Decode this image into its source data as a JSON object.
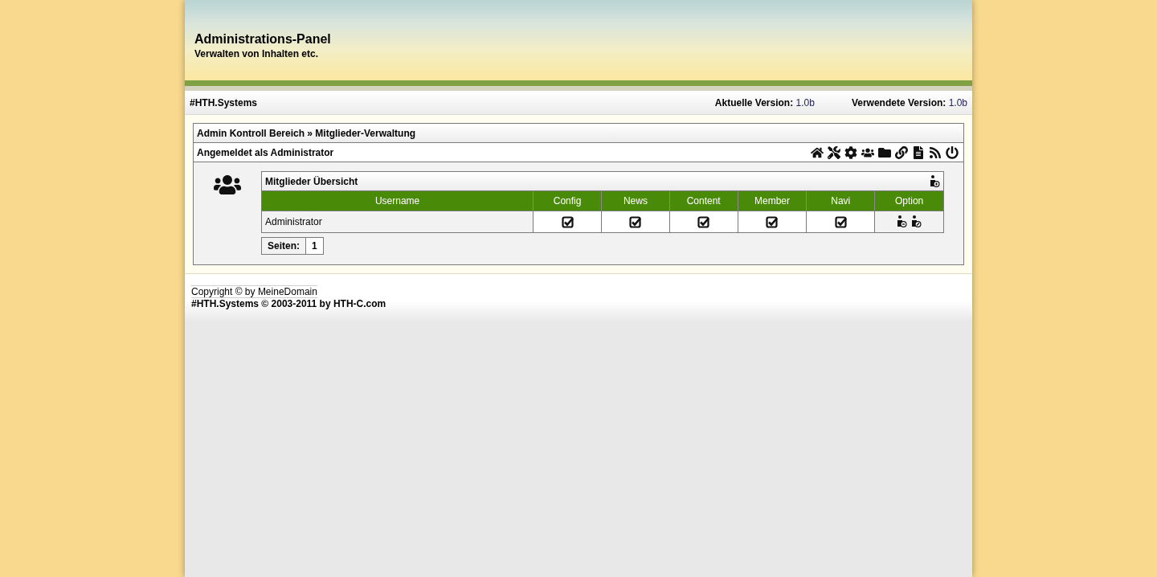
{
  "header": {
    "title": "Administrations-Panel",
    "subtitle": "Verwalten von Inhalten etc."
  },
  "topbar": {
    "site": "#HTH.Systems",
    "versions": [
      {
        "label": "Aktuelle Version:",
        "value": "1.0b"
      },
      {
        "label": "Verwendete Version:",
        "value": "1.0b"
      }
    ]
  },
  "breadcrumb": {
    "items": [
      "Admin Kontroll Bereich",
      "Mitglieder-Verwaltung"
    ],
    "separator": "»"
  },
  "login_text": "Angemeldet als Administrator",
  "members": {
    "title": "Mitglieder Übersicht",
    "columns": [
      "Username",
      "Config",
      "News",
      "Content",
      "Member",
      "Navi",
      "Option"
    ],
    "rows": [
      {
        "username": "Administrator",
        "permissions": [
          {
            "checked": true
          },
          {
            "checked": true
          },
          {
            "checked": true
          },
          {
            "checked": true
          },
          {
            "checked": true
          }
        ]
      }
    ]
  },
  "pagination": {
    "label": "Seiten:",
    "pages": [
      "1"
    ]
  },
  "footer": {
    "copyright": "Copyright © by MeineDomain",
    "credit": "#HTH.Systems © 2003-2011 by HTH-C.com"
  }
}
